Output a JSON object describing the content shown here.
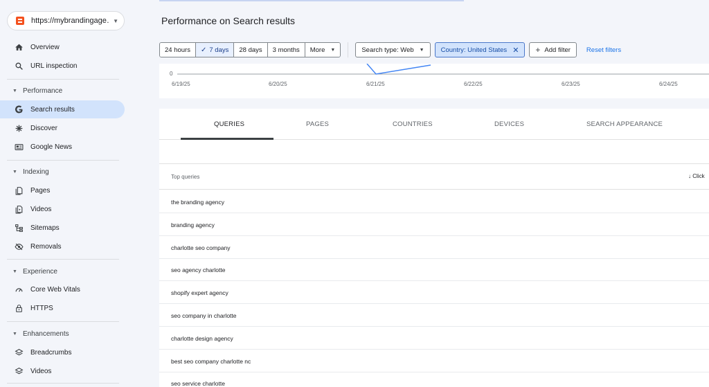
{
  "property": {
    "url": "https://mybrandingage…"
  },
  "nav": {
    "overview": "Overview",
    "url_inspection": "URL inspection",
    "performance_section": "Performance",
    "search_results": "Search results",
    "discover": "Discover",
    "google_news": "Google News",
    "indexing_section": "Indexing",
    "pages": "Pages",
    "videos": "Videos",
    "sitemaps": "Sitemaps",
    "removals": "Removals",
    "experience_section": "Experience",
    "core_web_vitals": "Core Web Vitals",
    "https": "HTTPS",
    "enhancements_section": "Enhancements",
    "breadcrumbs": "Breadcrumbs",
    "videos_enh": "Videos"
  },
  "main": {
    "title": "Performance on Search results"
  },
  "filters": {
    "range": [
      "24 hours",
      "7 days",
      "28 days",
      "3 months",
      "More"
    ],
    "selected_range": "7 days",
    "search_type": "Search type: Web",
    "country": "Country: United States",
    "add_filter": "Add filter",
    "reset": "Reset filters"
  },
  "chart": {
    "y_tick": "0",
    "x_ticks": [
      "6/19/25",
      "6/20/25",
      "6/21/25",
      "6/22/25",
      "6/23/25",
      "6/24/25"
    ]
  },
  "tabs": [
    "QUERIES",
    "PAGES",
    "COUNTRIES",
    "DEVICES",
    "SEARCH APPEARANCE"
  ],
  "table": {
    "header": "Top queries",
    "sort_label": "Click",
    "rows": [
      "the branding agency",
      "branding agency",
      "charlotte seo company",
      "seo agency charlotte",
      "shopify expert agency",
      "seo company in charlotte",
      "charlotte design agency",
      "best seo company charlotte nc",
      "seo service charlotte"
    ]
  },
  "colors": {
    "accent": "#1a73e8",
    "active_nav": "#d2e3fc",
    "chart_line": "#4285f4"
  }
}
